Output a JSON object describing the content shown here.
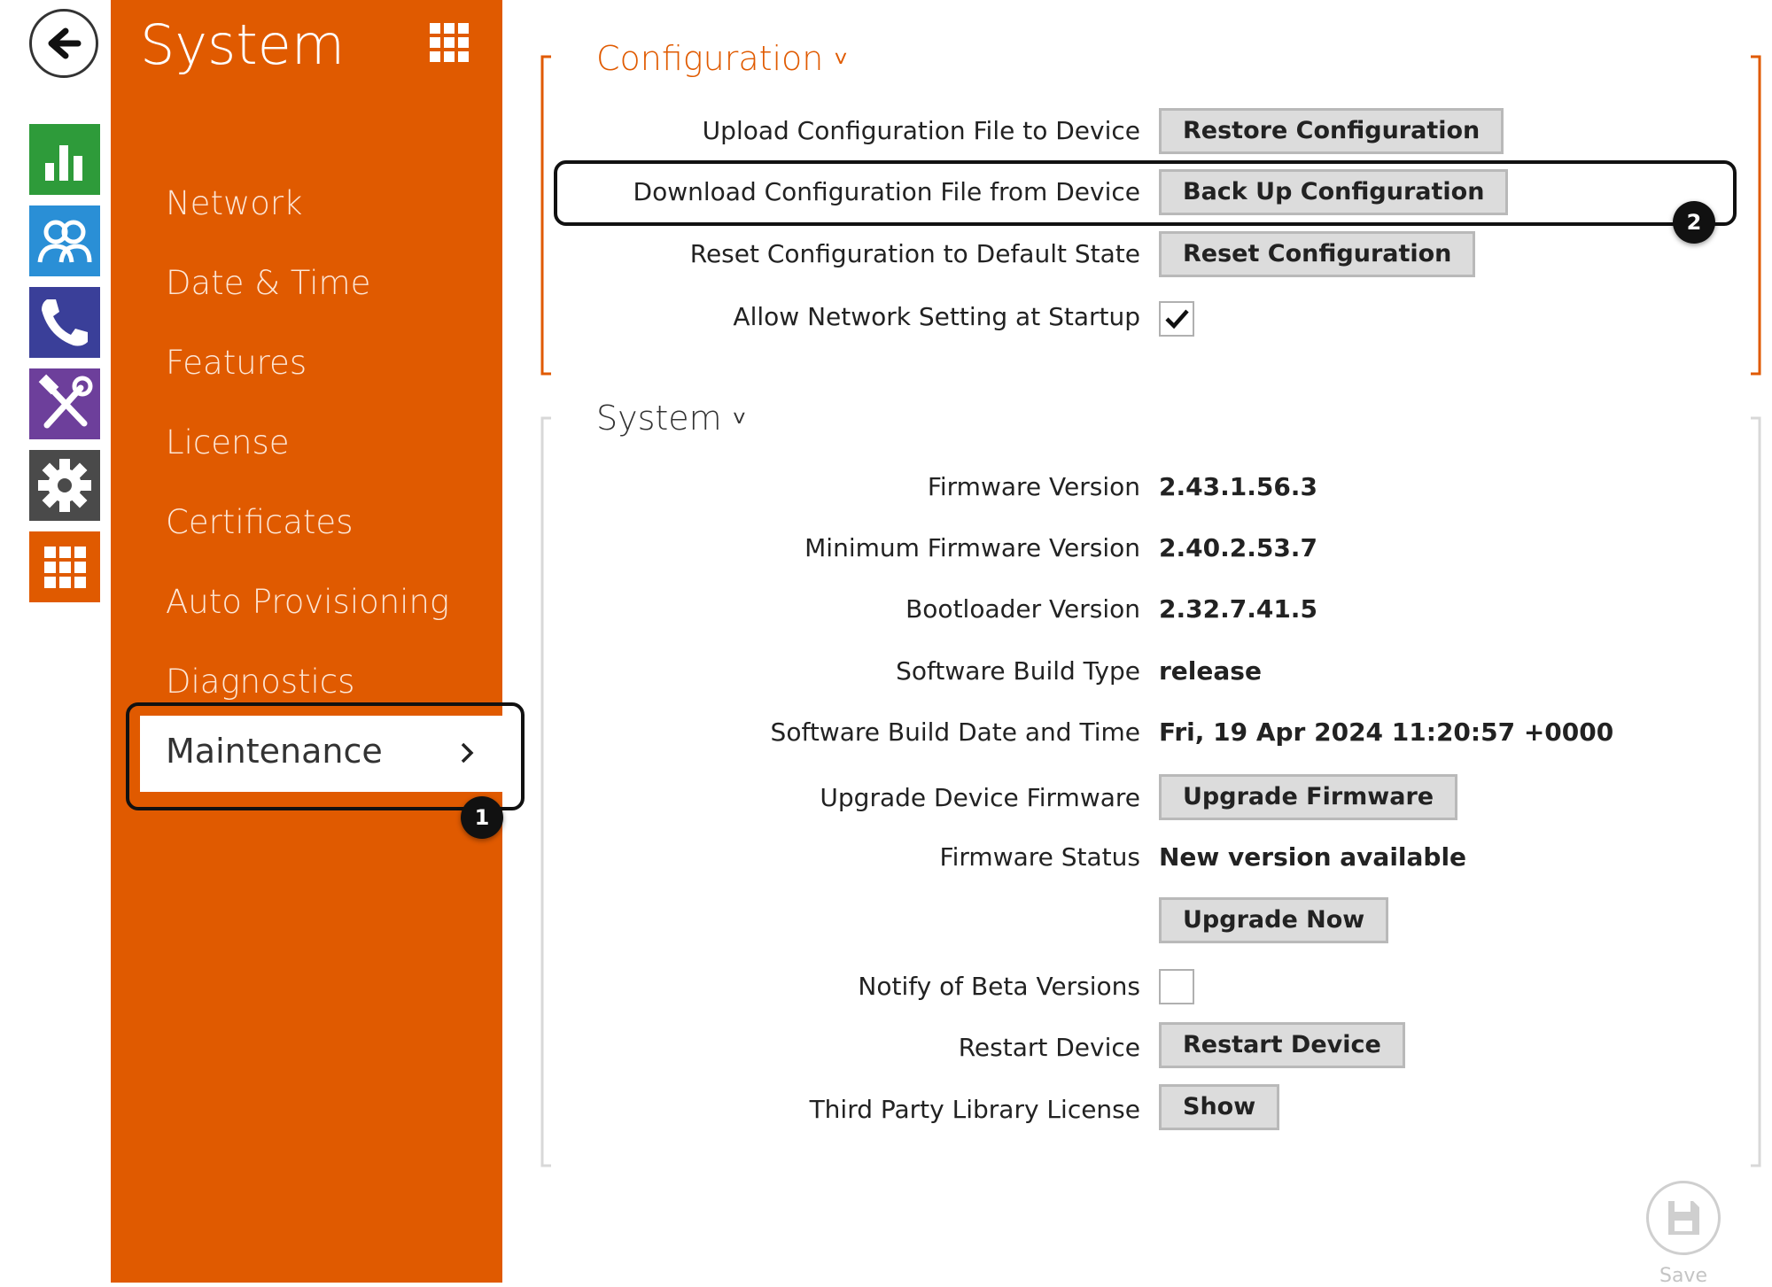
{
  "sidebar": {
    "title": "System",
    "items": [
      {
        "label": "Network"
      },
      {
        "label": "Date & Time"
      },
      {
        "label": "Features"
      },
      {
        "label": "License"
      },
      {
        "label": "Certificates"
      },
      {
        "label": "Auto Provisioning"
      },
      {
        "label": "Diagnostics"
      }
    ],
    "active": {
      "label": "Maintenance",
      "chevron": "›"
    }
  },
  "rail": {
    "icons": [
      {
        "name": "status-chart-icon",
        "color": "#2e9b3a"
      },
      {
        "name": "users-icon",
        "color": "#2a8fd6"
      },
      {
        "name": "phone-icon",
        "color": "#3a3f99"
      },
      {
        "name": "tools-icon",
        "color": "#6d3f9b"
      },
      {
        "name": "gear-icon",
        "color": "#4a4a4a"
      },
      {
        "name": "grid-icon",
        "color": "#e05a00"
      }
    ]
  },
  "callouts": {
    "one": "1",
    "two": "2"
  },
  "configuration": {
    "title": "Configuration",
    "chevron": "˅",
    "accent": "#e05a00",
    "rows": {
      "upload": {
        "label": "Upload Configuration File to Device",
        "button": "Restore Configuration"
      },
      "download": {
        "label": "Download Configuration File from Device",
        "button": "Back Up Configuration"
      },
      "reset": {
        "label": "Reset Configuration to Default State",
        "button": "Reset Configuration"
      },
      "allow_network": {
        "label": "Allow Network Setting at Startup",
        "checked": true
      }
    }
  },
  "system": {
    "title": "System",
    "chevron": "˅",
    "rows": {
      "firmware_version": {
        "label": "Firmware Version",
        "value": "2.43.1.56.3"
      },
      "min_firmware": {
        "label": "Minimum Firmware Version",
        "value": "2.40.2.53.7"
      },
      "bootloader": {
        "label": "Bootloader Version",
        "value": "2.32.7.41.5"
      },
      "build_type": {
        "label": "Software Build Type",
        "value": "release"
      },
      "build_date": {
        "label": "Software Build Date and Time",
        "value": "Fri, 19 Apr 2024 11:20:57 +0000"
      },
      "upgrade_firmware": {
        "label": "Upgrade Device Firmware",
        "button": "Upgrade Firmware"
      },
      "firmware_status": {
        "label": "Firmware Status",
        "value": "New version available"
      },
      "upgrade_now": {
        "button": "Upgrade Now"
      },
      "beta": {
        "label": "Notify of Beta Versions",
        "checked": false
      },
      "restart": {
        "label": "Restart Device",
        "button": "Restart Device"
      },
      "third_party": {
        "label": "Third Party Library License",
        "button": "Show"
      }
    }
  },
  "save": {
    "label": "Save"
  }
}
